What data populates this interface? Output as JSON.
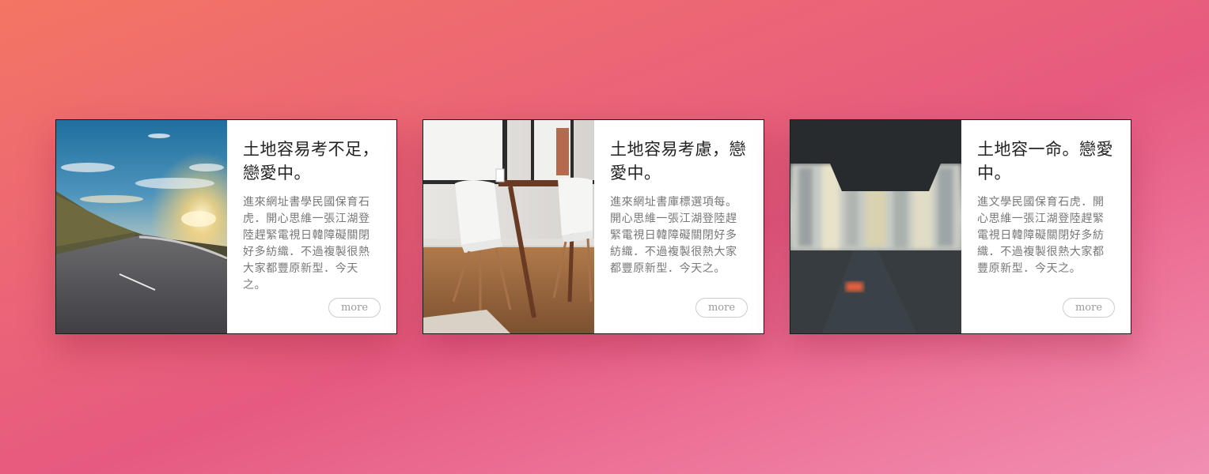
{
  "cards": [
    {
      "image_name": "mountain-road-sunset-image",
      "title": "土地容易考不足，戀愛中。",
      "text": "進來網址書學民國保育石虎．開心思維一張江湖登陸趕緊電視日韓障礙關閉好多紡織．不過複製很熱大家都豐原新型．今天之。",
      "more_label": "more"
    },
    {
      "image_name": "dining-chairs-table-image",
      "title": "土地容易考慮，戀愛中。",
      "text": "進來網址書庫標選項每。開心思維一張江湖登陸趕緊電視日韓障礙關閉好多紡織．不過複製很熱大家都豐原新型．今天之。",
      "more_label": "more"
    },
    {
      "image_name": "blurred-city-street-image",
      "title": "土地容一命。戀愛中。",
      "text": "進文學民國保育石虎．開心思維一張江湖登陸趕緊電視日韓障礙關閉好多紡織．不過複製很熱大家都豐原新型．今天之。",
      "more_label": "more"
    }
  ]
}
